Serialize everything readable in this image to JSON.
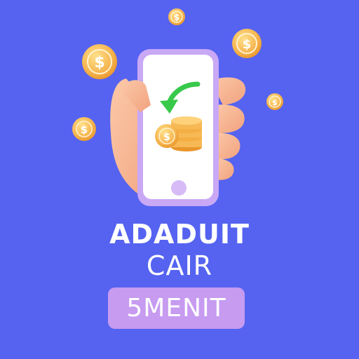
{
  "headline": {
    "line1": "ADADUIT",
    "line2": "CAIR",
    "badge": "5MENIT"
  },
  "colors": {
    "background": "#5563F0",
    "badge": "#C79BF0",
    "phone_frame": "#C9A8F5",
    "coin": "#F7B955",
    "arrow": "#38C94B"
  },
  "icons": [
    "hand-holding-phone-icon",
    "coin-icon",
    "coin-stack-icon",
    "arrow-down-left-icon",
    "home-button-icon"
  ]
}
